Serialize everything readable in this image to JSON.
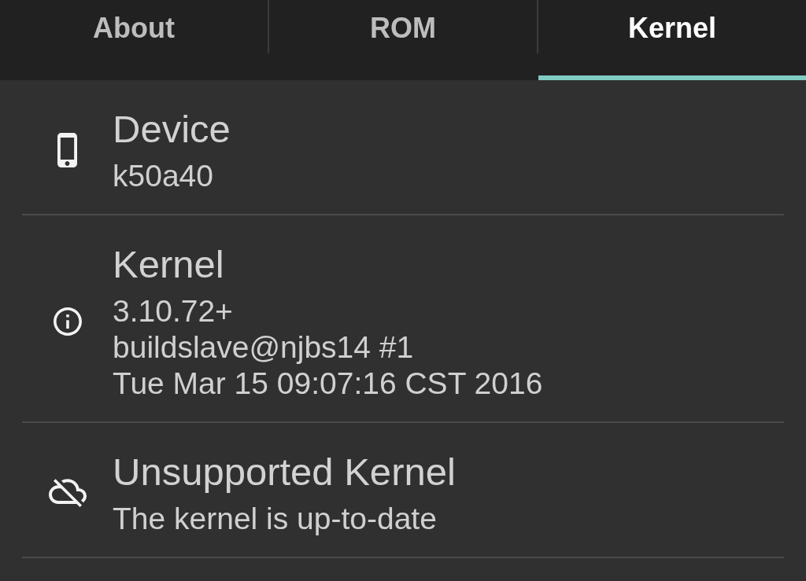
{
  "tabs": [
    {
      "label": "About",
      "selected": false
    },
    {
      "label": "ROM",
      "selected": false
    },
    {
      "label": "Kernel",
      "selected": true
    }
  ],
  "items": [
    {
      "title": "Device",
      "lines": [
        "k50a40"
      ]
    },
    {
      "title": "Kernel",
      "lines": [
        "3.10.72+",
        "buildslave@njbs14 #1",
        "Tue Mar 15 09:07:16 CST 2016"
      ]
    },
    {
      "title": "Unsupported Kernel",
      "lines": [
        "The kernel is up-to-date"
      ]
    }
  ]
}
